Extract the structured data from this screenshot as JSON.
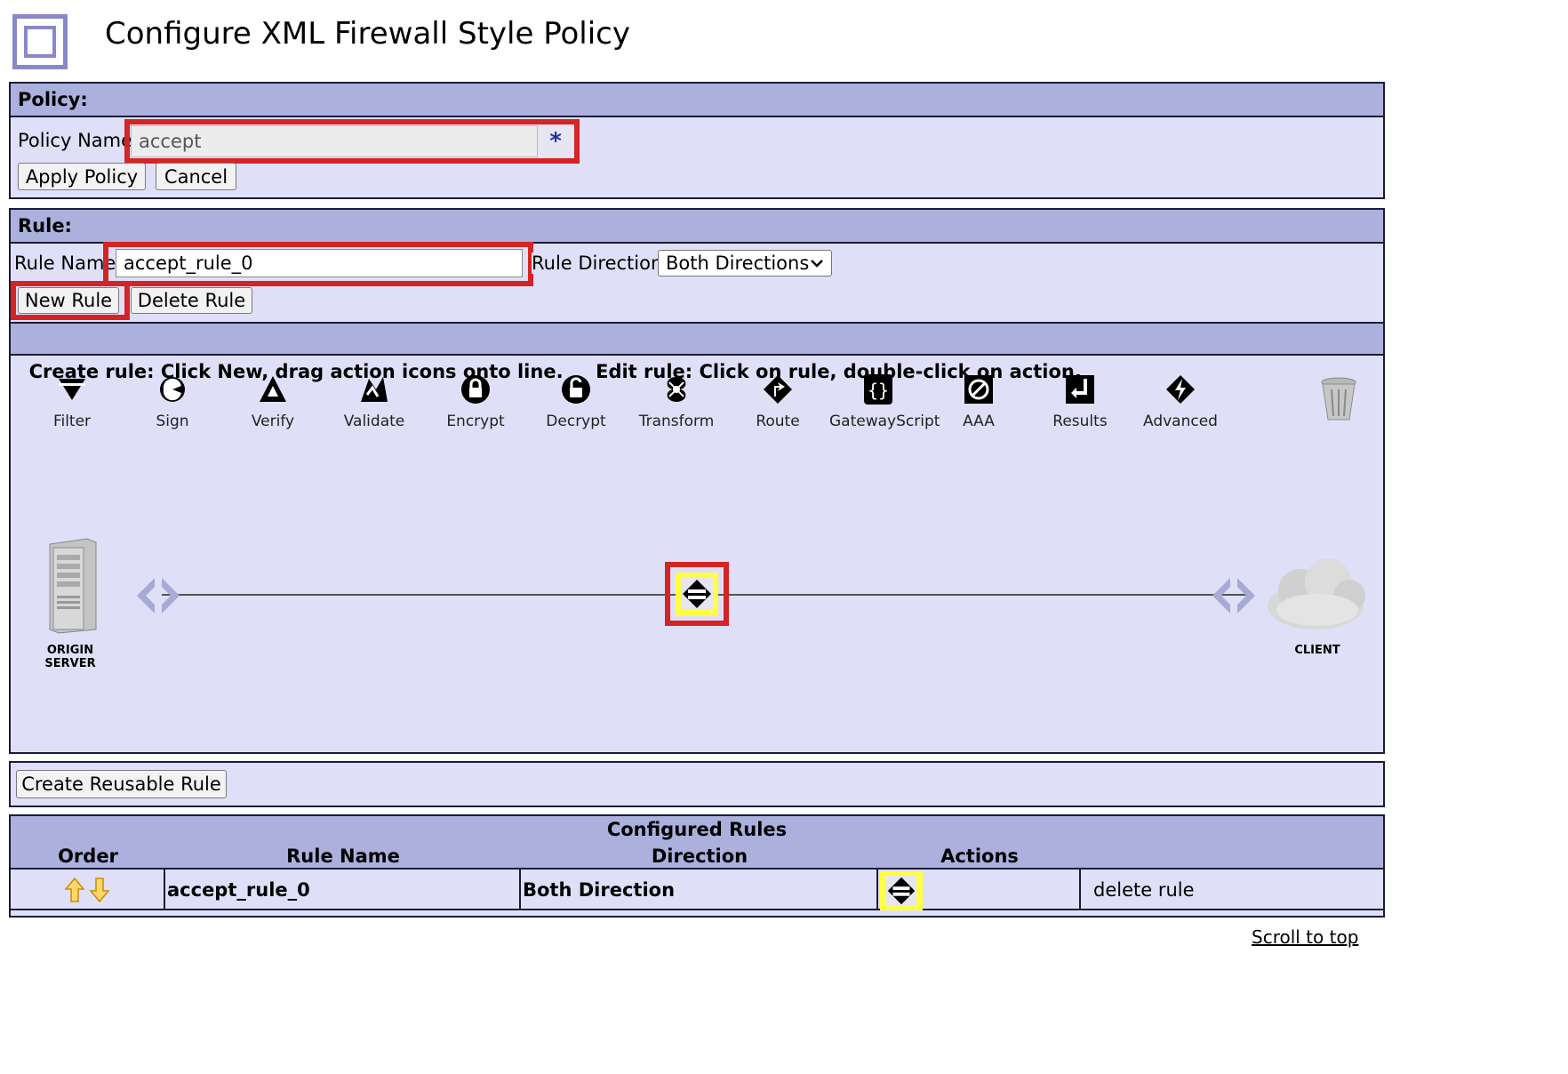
{
  "header": {
    "title": "Configure XML Firewall Style Policy"
  },
  "policy": {
    "section_label": "Policy:",
    "name_label": "Policy Name",
    "name_value": "accept",
    "required_mark": "*",
    "apply_label": "Apply Policy",
    "cancel_label": "Cancel"
  },
  "rule": {
    "section_label": "Rule:",
    "name_label": "Rule Name:",
    "name_value": "accept_rule_0",
    "direction_label": "Rule Direction:",
    "direction_value": "Both Directions",
    "new_label": "New Rule",
    "delete_label": "Delete Rule",
    "instructions": "Create rule: Click New, drag action icons onto line.     Edit rule: Click on rule, double-click on action."
  },
  "palette": [
    {
      "label": "Filter",
      "icon": "filter-icon"
    },
    {
      "label": "Sign",
      "icon": "sign-icon"
    },
    {
      "label": "Verify",
      "icon": "verify-icon"
    },
    {
      "label": "Validate",
      "icon": "validate-icon"
    },
    {
      "label": "Encrypt",
      "icon": "encrypt-icon"
    },
    {
      "label": "Decrypt",
      "icon": "decrypt-icon"
    },
    {
      "label": "Transform",
      "icon": "transform-icon"
    },
    {
      "label": "Route",
      "icon": "route-icon"
    },
    {
      "label": "GatewayScript",
      "icon": "gatewayscript-icon"
    },
    {
      "label": "AAA",
      "icon": "aaa-icon"
    },
    {
      "label": "Results",
      "icon": "results-icon"
    },
    {
      "label": "Advanced",
      "icon": "advanced-icon"
    }
  ],
  "flow": {
    "origin_label_1": "ORIGIN",
    "origin_label_2": "SERVER",
    "client_label": "CLIENT"
  },
  "reusable": {
    "button_label": "Create Reusable Rule"
  },
  "configured": {
    "title": "Configured Rules",
    "columns": [
      "Order",
      "Rule Name",
      "Direction",
      "Actions"
    ],
    "rows": [
      {
        "rule_name": "accept_rule_0",
        "direction": "Both Direction",
        "delete": "delete rule"
      }
    ]
  },
  "footer": {
    "scroll_top": "Scroll to top"
  },
  "colors": {
    "panel_bg": "#dfe0f8",
    "header_bg": "#abb0dd",
    "highlight_red": "#d42424",
    "match_yellow": "#ffff44",
    "logo": "#8a88c8"
  }
}
